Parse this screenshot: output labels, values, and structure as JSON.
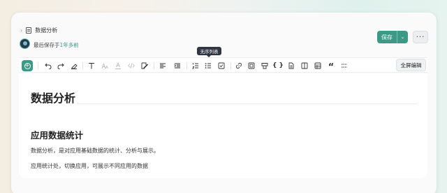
{
  "breadcrumb": {
    "doc_title": "数据分析"
  },
  "meta": {
    "saved_prefix": "最后保存于",
    "saved_relative": "1年多前"
  },
  "actions": {
    "save_label": "保存",
    "more_label": "···"
  },
  "tooltip": {
    "text": "无序列表"
  },
  "toolbar": {
    "fullscreen_label": "全屏编辑",
    "buttons": [
      {
        "icon": "add-icon"
      },
      {
        "icon": "undo-icon"
      },
      {
        "icon": "redo-icon"
      },
      {
        "icon": "eraser-icon"
      },
      {
        "icon": "text-style-icon"
      },
      {
        "icon": "font-size-icon"
      },
      {
        "icon": "font-color-icon"
      },
      {
        "icon": "inline-code-icon"
      },
      {
        "icon": "edit-icon"
      },
      {
        "icon": "align-left-icon"
      },
      {
        "icon": "indent-icon"
      },
      {
        "icon": "ordered-list-icon"
      },
      {
        "icon": "unordered-list-icon"
      },
      {
        "icon": "task-list-icon"
      },
      {
        "icon": "link-icon"
      },
      {
        "icon": "image-icon"
      },
      {
        "icon": "highlight-icon"
      },
      {
        "icon": "code-block-icon"
      },
      {
        "icon": "file-icon"
      },
      {
        "icon": "columns-icon"
      },
      {
        "icon": "table-icon"
      },
      {
        "icon": "quote-icon"
      },
      {
        "icon": "divider-icon"
      }
    ]
  },
  "content": {
    "title": "数据分析",
    "heading": "应用数据统计",
    "paragraph1": "数据分析，是对应用基础数据的统计、分析与展示。",
    "paragraph2": "应用统计处，切换应用，可展示不同应用的数据"
  },
  "colors": {
    "accent": "#3b9a86",
    "tooltip_bg": "#2f3542"
  }
}
